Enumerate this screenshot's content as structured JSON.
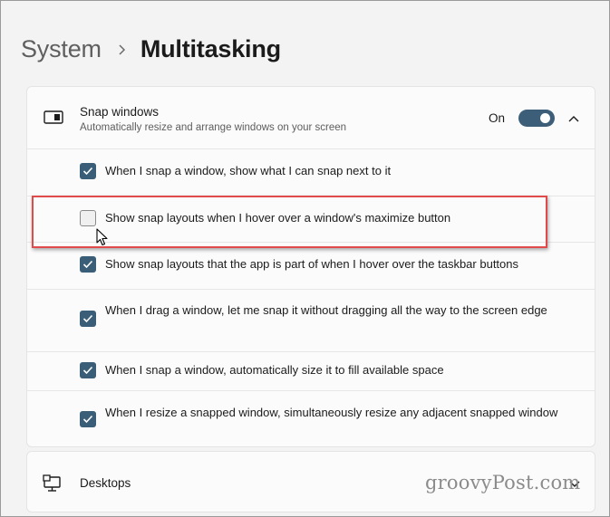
{
  "breadcrumb": {
    "parent": "System",
    "current": "Multitasking"
  },
  "snap_windows": {
    "title": "Snap windows",
    "description": "Automatically resize and arrange windows on your screen",
    "toggle_state_label": "On",
    "toggle_on": true,
    "icon": "snap-windows-icon",
    "options": [
      {
        "label": "When I snap a window, show what I can snap next to it",
        "checked": true
      },
      {
        "label": "Show snap layouts when I hover over a window's maximize button",
        "checked": false
      },
      {
        "label": "Show snap layouts that the app is part of when I hover over the taskbar buttons",
        "checked": true
      },
      {
        "label": "When I drag a window, let me snap it without dragging all the way to the screen edge",
        "checked": true
      },
      {
        "label": "When I snap a window, automatically size it to fill available space",
        "checked": true
      },
      {
        "label": "When I resize a snapped window, simultaneously resize any adjacent snapped window",
        "checked": true
      }
    ]
  },
  "desktops": {
    "title": "Desktops",
    "icon": "desktops-icon"
  },
  "watermark": "groovyPost.com",
  "colors": {
    "accent": "#3a5d78",
    "highlight": "#e04a4a",
    "background": "#f3f3f3",
    "card": "#fbfbfb"
  }
}
